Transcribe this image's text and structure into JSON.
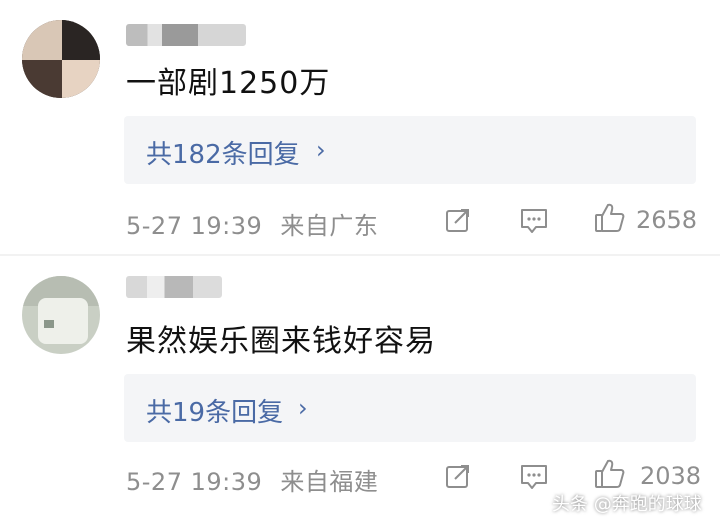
{
  "comments": [
    {
      "content": "一部剧1250万",
      "replies_label": "共182条回复",
      "chevron": "›",
      "timestamp": "5-27 19:39",
      "location": "来自广东",
      "likes": "2658"
    },
    {
      "content": "果然娱乐圈来钱好容易",
      "replies_label": "共19条回复",
      "chevron": "›",
      "timestamp": "5-27 19:39",
      "location": "来自福建",
      "likes": "2038"
    }
  ],
  "icons": {
    "share": "share-icon",
    "comment": "comment-icon",
    "like": "thumbs-up-icon"
  },
  "colors": {
    "link": "#4a6aa5",
    "meta": "#8e8e8e",
    "reply_bg": "#f4f5f7"
  },
  "watermark": "头条 @奔跑的球球"
}
